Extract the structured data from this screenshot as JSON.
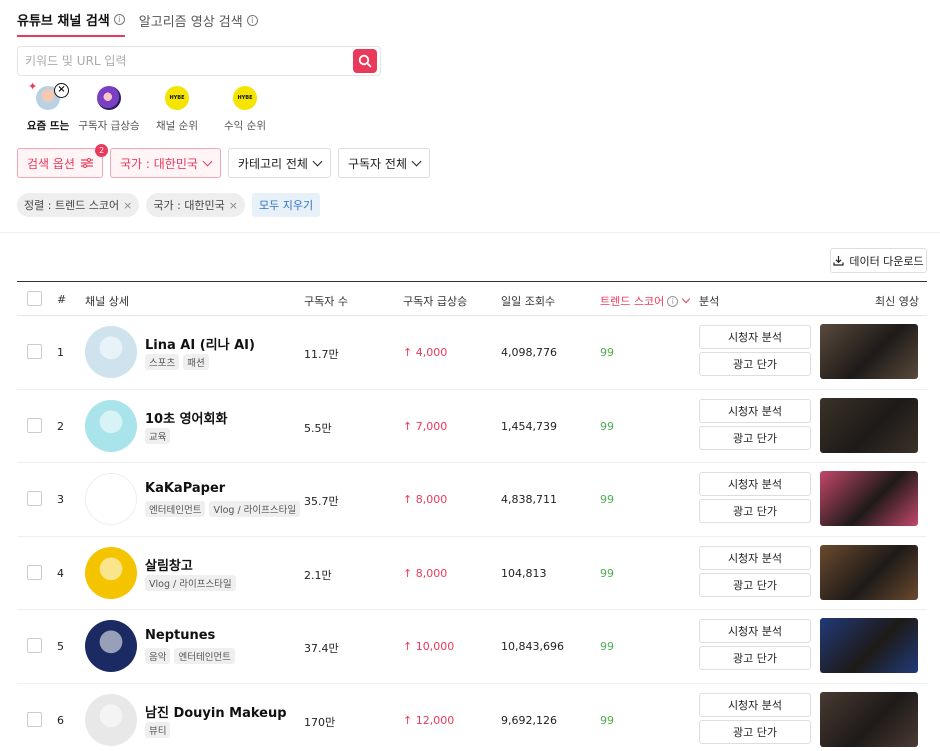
{
  "tabs": [
    {
      "label": "유튜브 채널 검색",
      "active": true
    },
    {
      "label": "알고리즘 영상 검색",
      "active": false
    }
  ],
  "search": {
    "placeholder": "키워드 및 URL 입력",
    "value": ""
  },
  "quick": [
    {
      "label": "요즘 뜨는",
      "active": true,
      "icon": "trending-avatar"
    },
    {
      "label": "구독자 급상승",
      "active": false,
      "icon": "growth-avatar"
    },
    {
      "label": "채널 순위",
      "active": false,
      "icon": "hybe-logo",
      "logo_text": "HYBE"
    },
    {
      "label": "수익 순위",
      "active": false,
      "icon": "hybe-logo",
      "logo_text": "HYBE"
    }
  ],
  "filters": {
    "options": {
      "label": "검색 옵션",
      "count": "2"
    },
    "country": "국가 : 대한민국",
    "category": "카테고리 전체",
    "subscribers": "구독자 전체"
  },
  "chips": {
    "sort": "정렬 : 트렌드 스코어",
    "country": "국가 : 대한민국",
    "clear": "모두 지우기"
  },
  "download_label": "데이터 다운로드",
  "table": {
    "headers": {
      "rank": "#",
      "channel": "채널 상세",
      "subs": "구독자 수",
      "growth": "구독자 급상승",
      "views": "일일 조회수",
      "score": "트렌드 스코어",
      "analysis": "분석",
      "latest": "최신 영상"
    },
    "buttons": {
      "viewer": "시청자 분석",
      "ad": "광고 단가"
    },
    "rows": [
      {
        "rank": "1",
        "name": "Lina AI (리나 AI)",
        "cats": [
          "스포츠",
          "패션"
        ],
        "subs": "11.7만",
        "growth": "↑ 4,000",
        "views": "4,098,776",
        "score": "99",
        "avatar_color": "#cfe3ef",
        "thumb_color": "#5a4a3c"
      },
      {
        "rank": "2",
        "name": "10초 영어회화",
        "cats": [
          "교육"
        ],
        "subs": "5.5만",
        "growth": "↑ 7,000",
        "views": "1,454,739",
        "score": "99",
        "avatar_color": "#a8e4ea",
        "thumb_color": "#3a3228"
      },
      {
        "rank": "3",
        "name": "KaKaPaper",
        "cats": [
          "엔터테인먼트",
          "Vlog / 라이프스타일"
        ],
        "subs": "35.7만",
        "growth": "↑ 8,000",
        "views": "4,838,711",
        "score": "99",
        "avatar_color": "#ffffff",
        "thumb_color": "#c4476a"
      },
      {
        "rank": "4",
        "name": "살림창고",
        "cats": [
          "Vlog / 라이프스타일"
        ],
        "subs": "2.1만",
        "growth": "↑ 8,000",
        "views": "104,813",
        "score": "99",
        "avatar_color": "#f5c400",
        "thumb_color": "#6b4a2e"
      },
      {
        "rank": "5",
        "name": "Neptunes",
        "cats": [
          "음악",
          "엔터테인먼트"
        ],
        "subs": "37.4만",
        "growth": "↑ 10,000",
        "views": "10,843,696",
        "score": "99",
        "avatar_color": "#1b2a63",
        "thumb_color": "#203a78"
      },
      {
        "rank": "6",
        "name": "남진 Douyin Makeup",
        "cats": [
          "뷰티"
        ],
        "subs": "170만",
        "growth": "↑ 12,000",
        "views": "9,692,126",
        "score": "99",
        "avatar_color": "#e8e8e8",
        "thumb_color": "#4a3a34"
      }
    ]
  }
}
